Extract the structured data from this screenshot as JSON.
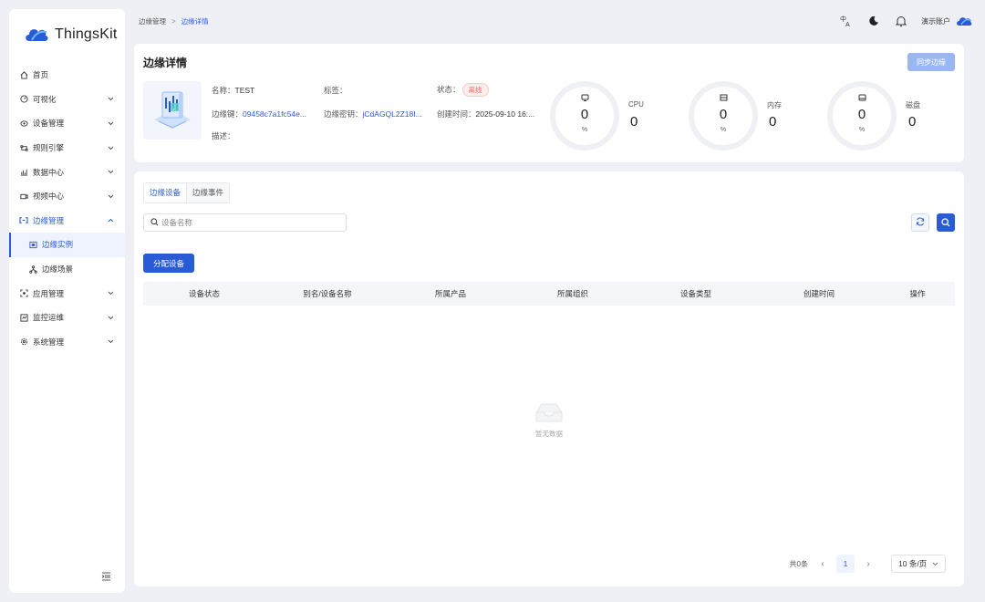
{
  "app": {
    "logo_text": "ThingsKit"
  },
  "sidebar": {
    "items": [
      {
        "label": "首页",
        "icon": "home-icon"
      },
      {
        "label": "可视化",
        "icon": "dashboard-icon"
      },
      {
        "label": "设备管理",
        "icon": "device-icon"
      },
      {
        "label": "规则引擎",
        "icon": "rule-icon"
      },
      {
        "label": "数据中心",
        "icon": "chart-icon"
      },
      {
        "label": "视频中心",
        "icon": "video-icon"
      },
      {
        "label": "边缘管理",
        "icon": "edge-icon"
      },
      {
        "label": "边缘实例",
        "icon": "instance-icon"
      },
      {
        "label": "边缘场景",
        "icon": "scene-icon"
      },
      {
        "label": "应用管理",
        "icon": "app-icon"
      },
      {
        "label": "监控运维",
        "icon": "monitor-icon"
      },
      {
        "label": "系统管理",
        "icon": "settings-icon"
      }
    ]
  },
  "header": {
    "breadcrumb": [
      "边缘管理",
      "边缘详情"
    ],
    "breadcrumb_sep": ">",
    "account": "演示账户"
  },
  "detail": {
    "title": "边缘详情",
    "sync_button": "同步边缘",
    "name_label": "名称：",
    "name_value": "TEST",
    "tag_label": "标签：",
    "tag_value": "",
    "status_label": "状态：",
    "status_value": "离线",
    "edge_key_label": "边缘键：",
    "edge_key_value": "09458c7a1fc54e...",
    "edge_secret_label": "边缘密钥：",
    "edge_secret_value": "jCdAGQL2Z18I...",
    "created_label": "创建时间：",
    "created_value": "2025-09-10 16:...",
    "desc_label": "描述：",
    "desc_value": "",
    "metrics": [
      {
        "label": "CPU",
        "value": "0",
        "gauge_value": "0",
        "unit": "%",
        "icon": "cpu-icon"
      },
      {
        "label": "内存",
        "value": "0",
        "gauge_value": "0",
        "unit": "%",
        "icon": "memory-icon"
      },
      {
        "label": "磁盘",
        "value": "0",
        "gauge_value": "0",
        "unit": "%",
        "icon": "disk-icon"
      }
    ]
  },
  "devices": {
    "tabs": [
      "边缘设备",
      "边缘事件"
    ],
    "search_placeholder": "设备名称",
    "assign_button": "分配设备",
    "columns": [
      "设备状态",
      "别名/设备名称",
      "所属产品",
      "所属组织",
      "设备类型",
      "创建时间",
      "操作"
    ],
    "empty_text": "暂无数据",
    "pagination": {
      "total": "共0条",
      "page": "1",
      "page_size": "10 条/页"
    }
  },
  "colors": {
    "primary": "#2a5bd7",
    "offline": "#f56c6c"
  }
}
